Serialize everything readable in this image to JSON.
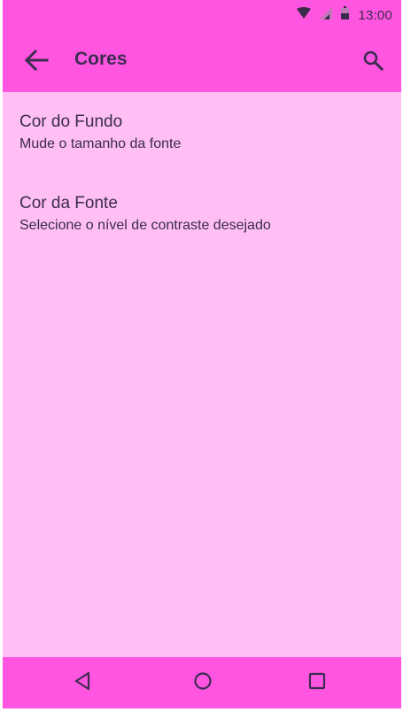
{
  "status_bar": {
    "time": "13:00",
    "icons": [
      "wifi-icon",
      "signal-icon",
      "battery-icon"
    ]
  },
  "app_bar": {
    "title": "Cores",
    "back_icon": "arrow-back-icon",
    "search_icon": "search-icon"
  },
  "preferences": [
    {
      "title": "Cor do Fundo",
      "summary": "Mude o tamanho da fonte"
    },
    {
      "title": "Cor da Fonte",
      "summary": "Selecione o nível de contraste desejado"
    }
  ],
  "nav_bar": {
    "icons": [
      "nav-back-icon",
      "nav-home-icon",
      "nav-recents-icon"
    ]
  },
  "colors": {
    "bar": "#FF55E1",
    "content_background": "#FFBFF5",
    "text": "#3A2C4A"
  }
}
